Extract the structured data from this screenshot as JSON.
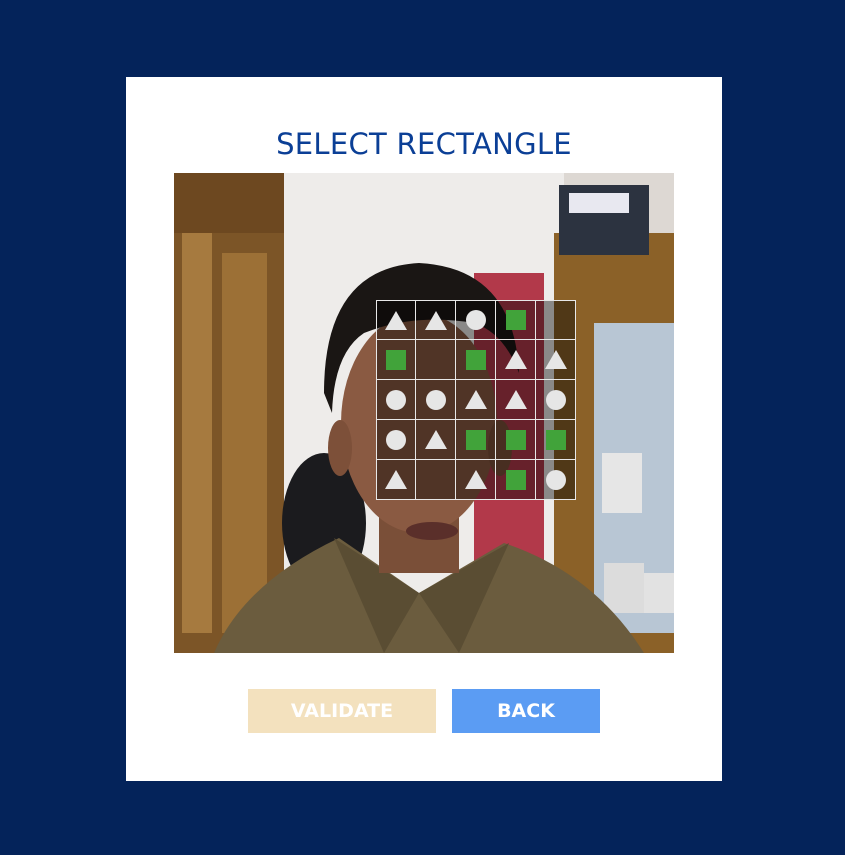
{
  "dialog": {
    "title": "SELECT RECTANGLE"
  },
  "captcha": {
    "target_shape": "square",
    "grid": [
      [
        "triangle",
        "triangle",
        "circle",
        "square",
        ""
      ],
      [
        "square",
        "",
        "square",
        "triangle",
        "triangle"
      ],
      [
        "circle",
        "circle",
        "triangle",
        "triangle",
        "circle"
      ],
      [
        "circle",
        "triangle",
        "square",
        "square",
        "square"
      ],
      [
        "triangle",
        "",
        "triangle",
        "square",
        "circle"
      ]
    ]
  },
  "buttons": {
    "validate_label": "VALIDATE",
    "back_label": "BACK"
  },
  "colors": {
    "page_background": "#04235a",
    "title": "#0b3f96",
    "square_shape": "#41a33a",
    "light_shape": "#e6e6e6",
    "validate_button": "#f3e1be",
    "back_button": "#5b9cf3"
  }
}
